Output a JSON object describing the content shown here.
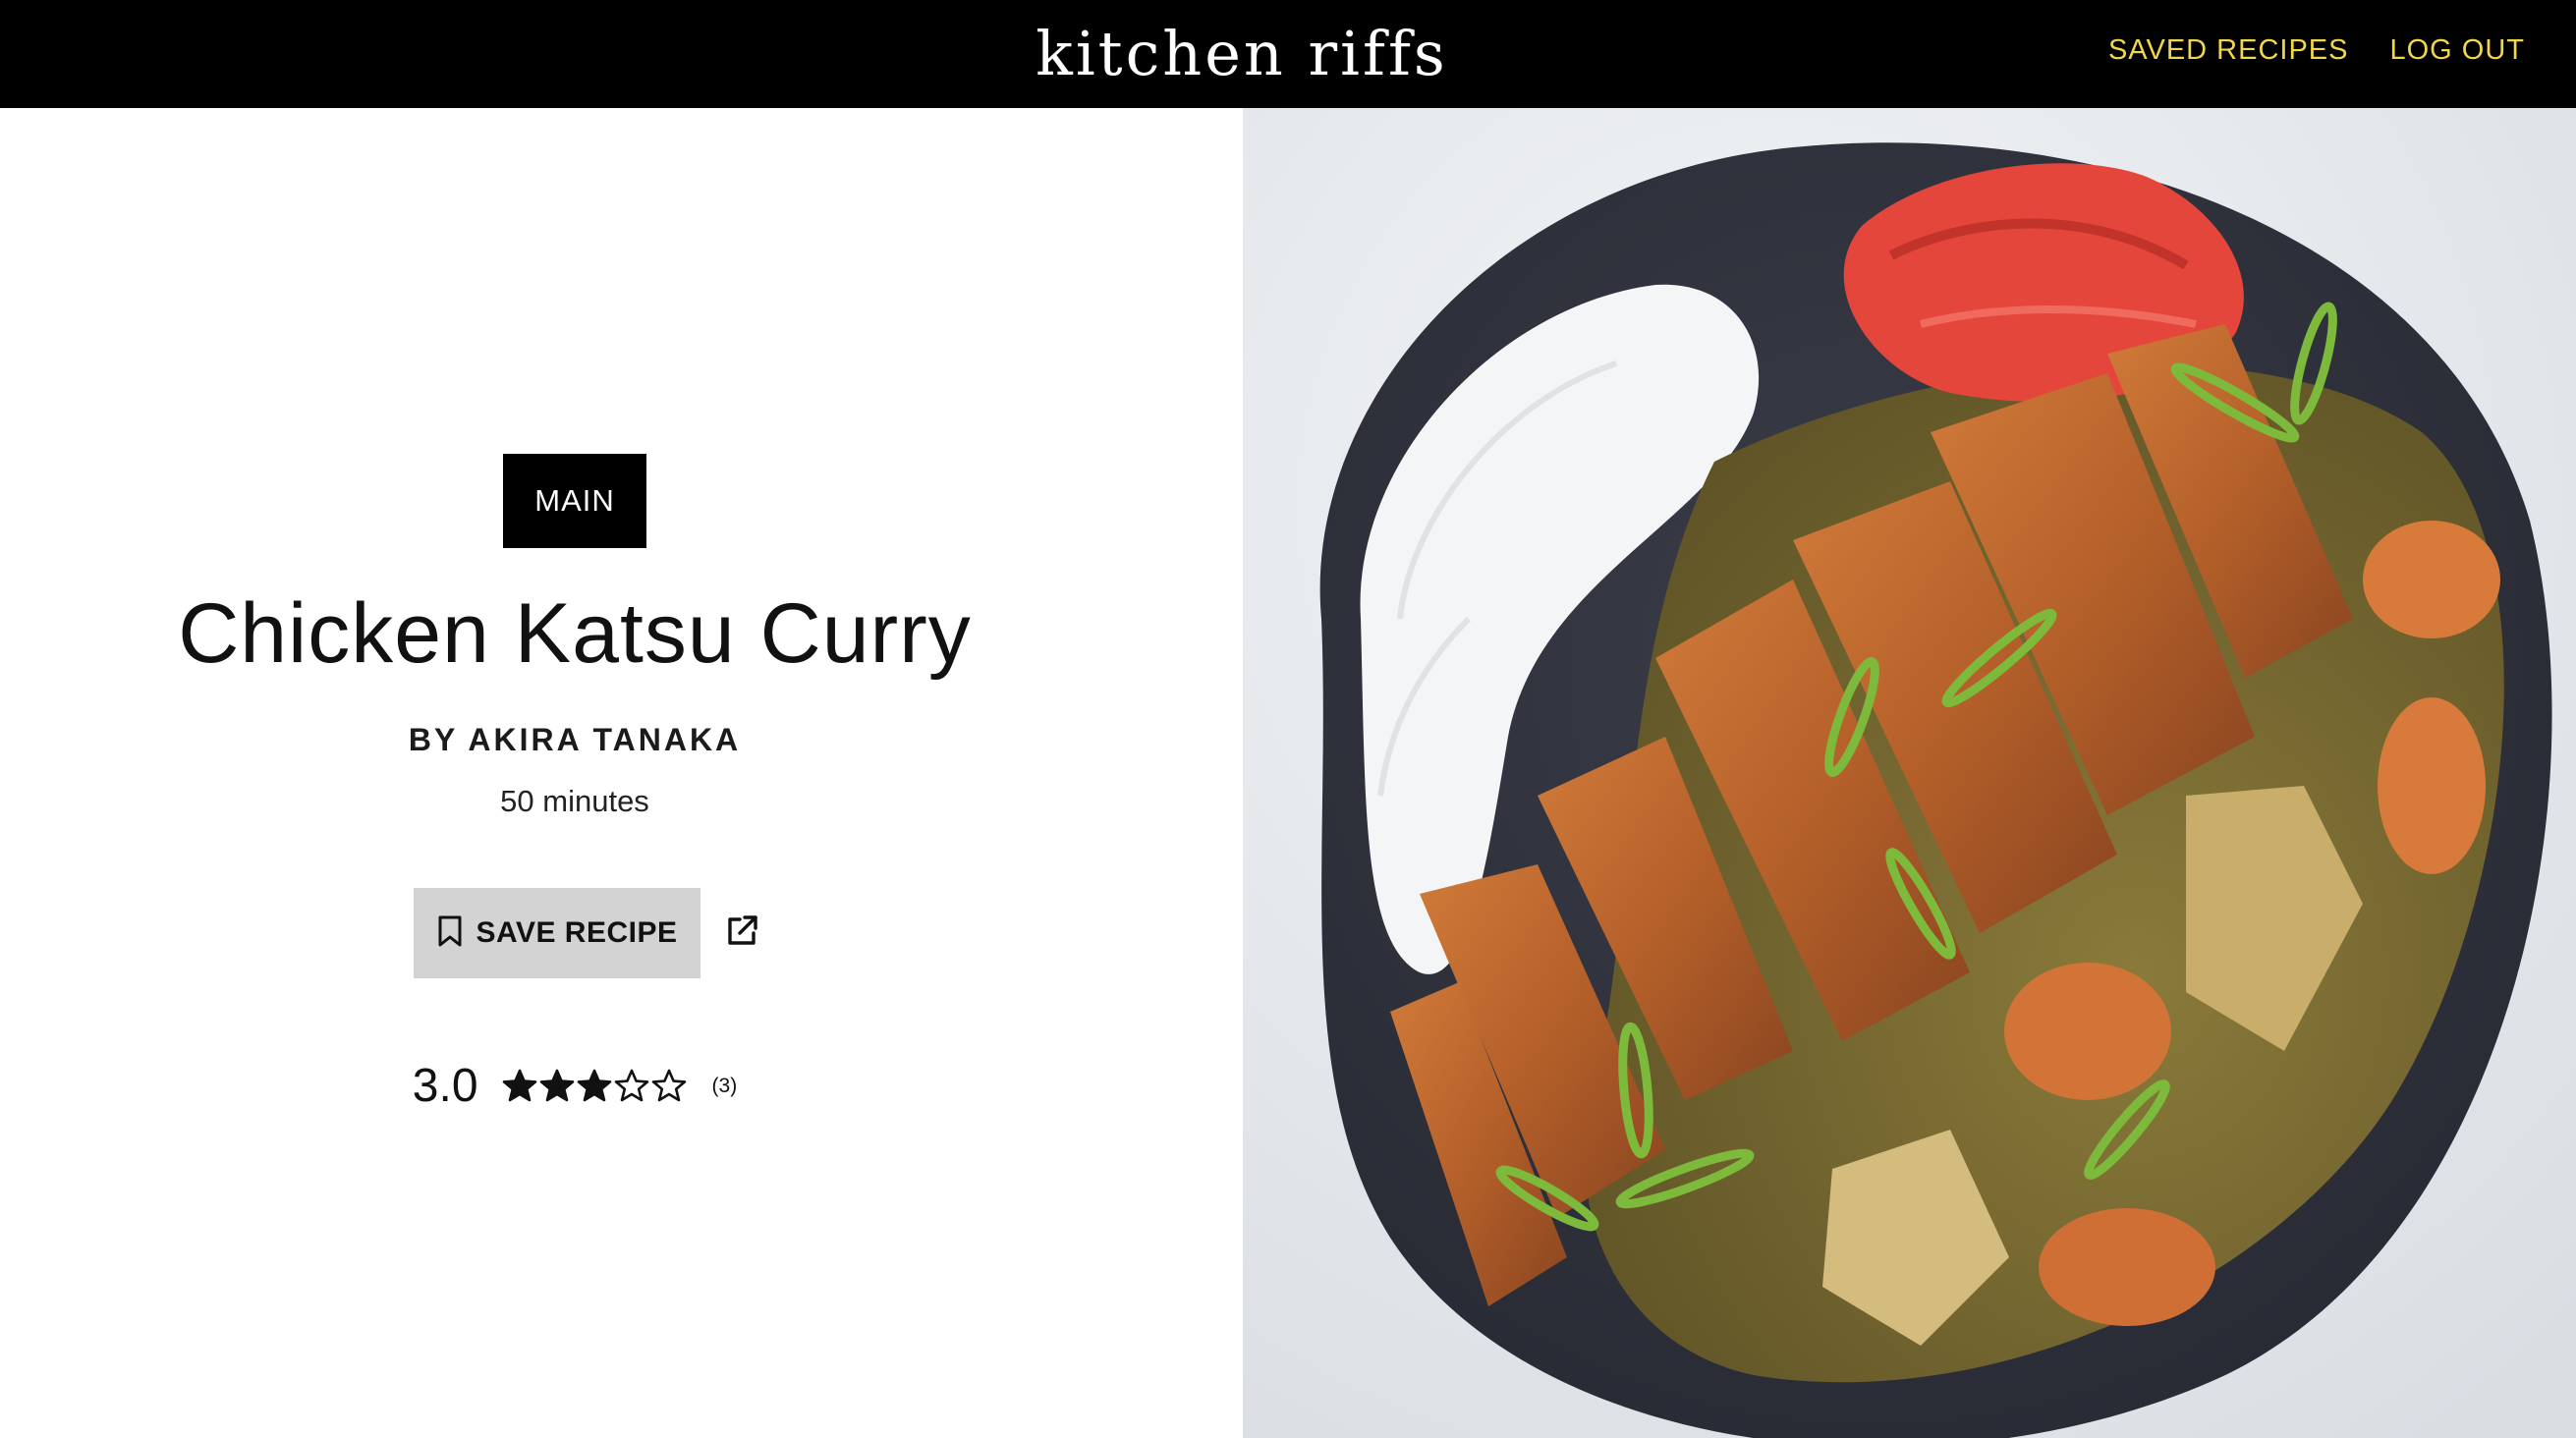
{
  "header": {
    "logo": "kitchen riffs",
    "nav": [
      {
        "label": "SAVED RECIPES"
      },
      {
        "label": "LOG OUT"
      }
    ]
  },
  "recipe": {
    "category": "MAIN",
    "title": "Chicken Katsu Curry",
    "author": "BY AKIRA TANAKA",
    "time": "50 minutes",
    "save_label": "SAVE RECIPE",
    "rating": {
      "score": "3.0",
      "stars_filled": 3,
      "stars_total": 5,
      "count": "(3)"
    }
  },
  "icons": {
    "bookmark": "bookmark-icon",
    "external": "external-link-icon",
    "star": "star-icon"
  },
  "colors": {
    "header_bg": "#000000",
    "nav_text": "#f2d64b",
    "badge_bg": "#000000",
    "save_button_bg": "#d3d3d3"
  }
}
